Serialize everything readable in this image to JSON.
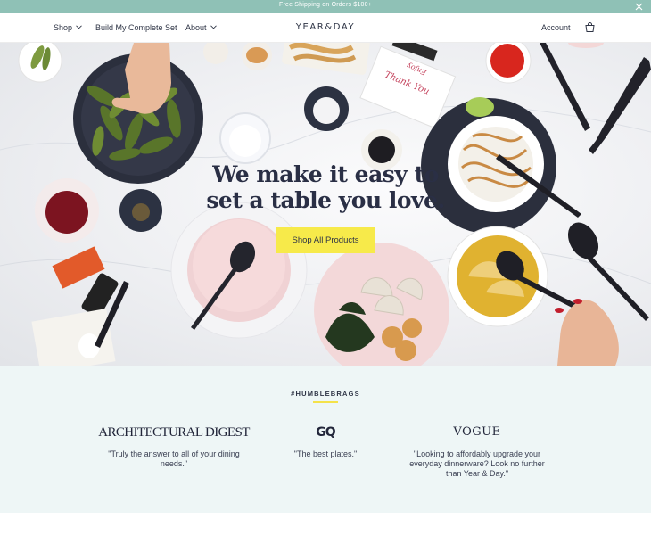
{
  "announcement": {
    "text": "Free Shipping on Orders $100+"
  },
  "nav": {
    "shop": "Shop",
    "build_set": "Build My Complete Set",
    "about": "About",
    "logo": "YEAR&DAY",
    "account": "Account"
  },
  "hero": {
    "headline_line1": "We make it easy to",
    "headline_line2": "set a table you love.",
    "cta": "Shop All Products",
    "takeout_box_text": "Thank You  Enjoy"
  },
  "brags": {
    "title": "#HUMBLEBRAGS",
    "items": [
      {
        "publication": "ARCHITECTURAL DIGEST",
        "quote": "\"Truly the answer to all of your dining needs.\""
      },
      {
        "publication": "GQ",
        "quote": "\"The best plates.\""
      },
      {
        "publication": "VOGUE",
        "quote": "\"Looking to affordably upgrade your everyday dinnerware? Look no further than Year & Day.\""
      }
    ]
  },
  "colors": {
    "announcement_bg": "#8fc1b6",
    "cta_bg": "#f7ea4a",
    "brags_bg": "#eef6f6",
    "text_dark": "#2f3546"
  }
}
